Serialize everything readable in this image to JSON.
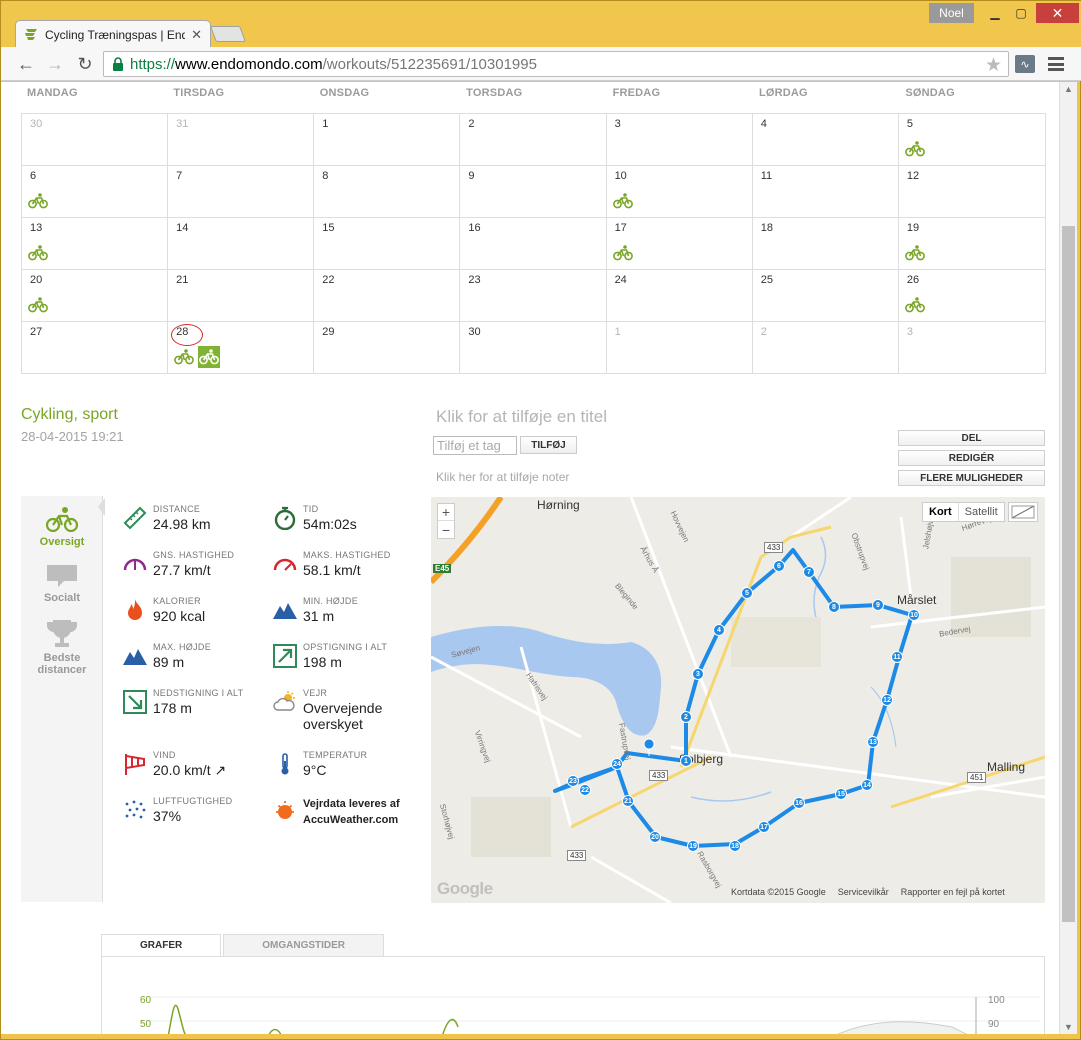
{
  "browser": {
    "tab_title": "Cycling Træningspas | Endomondo",
    "user": "Noel",
    "url_protocol": "https://",
    "url_host": "www.endomondo.com",
    "url_path": "/workouts/512235691/10301995"
  },
  "calendar": {
    "weekdays": [
      "MANDAG",
      "TIRSDAG",
      "ONSDAG",
      "TORSDAG",
      "FREDAG",
      "LØRDAG",
      "SØNDAG"
    ],
    "days": [
      "30",
      "31",
      "1",
      "2",
      "3",
      "4",
      "5",
      "6",
      "7",
      "8",
      "9",
      "10",
      "11",
      "12",
      "13",
      "14",
      "15",
      "16",
      "17",
      "18",
      "19",
      "20",
      "21",
      "22",
      "23",
      "24",
      "25",
      "26",
      "27",
      "28",
      "29",
      "30",
      "1",
      "2",
      "3"
    ]
  },
  "workout": {
    "title": "Cykling, sport",
    "date": "28-04-2015 19:21",
    "add_title": "Klik for at tilføje en titel",
    "tag_placeholder": "Tilføj et tag",
    "tag_button": "TILFØJ",
    "notes": "Klik her for at tilføje noter",
    "actions": {
      "share": "DEL",
      "edit": "REDIGÉR",
      "more": "FLERE MULIGHEDER"
    }
  },
  "sidebar": {
    "items": [
      {
        "label": "Oversigt"
      },
      {
        "label": "Socialt"
      },
      {
        "label": "Bedste distancer"
      }
    ]
  },
  "stats": {
    "distance": {
      "label": "DISTANCE",
      "value": "24.98 km"
    },
    "time": {
      "label": "TID",
      "value": "54m:02s"
    },
    "avg_speed": {
      "label": "GNS. HASTIGHED",
      "value": "27.7 km/t"
    },
    "max_speed": {
      "label": "MAKS. HASTIGHED",
      "value": "58.1 km/t"
    },
    "calories": {
      "label": "KALORIER",
      "value": "920 kcal"
    },
    "min_height": {
      "label": "MIN. HØJDE",
      "value": "31 m"
    },
    "max_height": {
      "label": "MAX. HØJDE",
      "value": "89 m"
    },
    "ascent": {
      "label": "OPSTIGNING I ALT",
      "value": "198 m"
    },
    "descent": {
      "label": "NEDSTIGNING I ALT",
      "value": "178 m"
    },
    "weather": {
      "label": "VEJR",
      "value": "Overvejende overskyet"
    },
    "wind": {
      "label": "VIND",
      "value": "20.0 km/t ↗"
    },
    "temperature": {
      "label": "TEMPERATUR",
      "value": "9°C"
    },
    "humidity": {
      "label": "LUFTFUGTIGHED",
      "value": "37%"
    },
    "weather_provider_line1": "Vejrdata leveres af",
    "weather_provider_line2": "AccuWeather.com"
  },
  "map": {
    "zoom_in": "+",
    "zoom_out": "−",
    "type_map": "Kort",
    "type_satellite": "Satellit",
    "places": [
      "Hørning",
      "Mårslet",
      "Malling",
      "Solbjerg"
    ],
    "roads": [
      "Søvejen",
      "Hafrisvej",
      "Virringvej",
      "Storhøjvej",
      "Bleginde",
      "Hovvejen",
      "Århus Å",
      "Obstrupvej",
      "Jelshøjvej",
      "Bedervej",
      "Rasborgvej",
      "Fastrupvej",
      "Hørrevej"
    ],
    "road_numbers": [
      "433",
      "433",
      "433",
      "451"
    ],
    "motorway": "E45",
    "logo": "Google",
    "attribution": "Kortdata ©2015 Google",
    "terms": "Servicevilkår",
    "report": "Rapporter en fejl på kortet",
    "markers": [
      "1",
      "2",
      "3",
      "4",
      "5",
      "6",
      "7",
      "8",
      "9",
      "10",
      "11",
      "12",
      "13",
      "14",
      "15",
      "16",
      "17",
      "18",
      "19",
      "20",
      "21",
      "22",
      "23",
      "24"
    ]
  },
  "graph": {
    "tabs": [
      "GRAFER",
      "OMGANGSTIDER"
    ],
    "left_ticks": [
      "60",
      "50"
    ],
    "right_ticks": [
      "100",
      "90"
    ]
  },
  "colors": {
    "accent": "#7aa626",
    "route": "#1c8ae6",
    "today_ring": "#d9262e"
  }
}
